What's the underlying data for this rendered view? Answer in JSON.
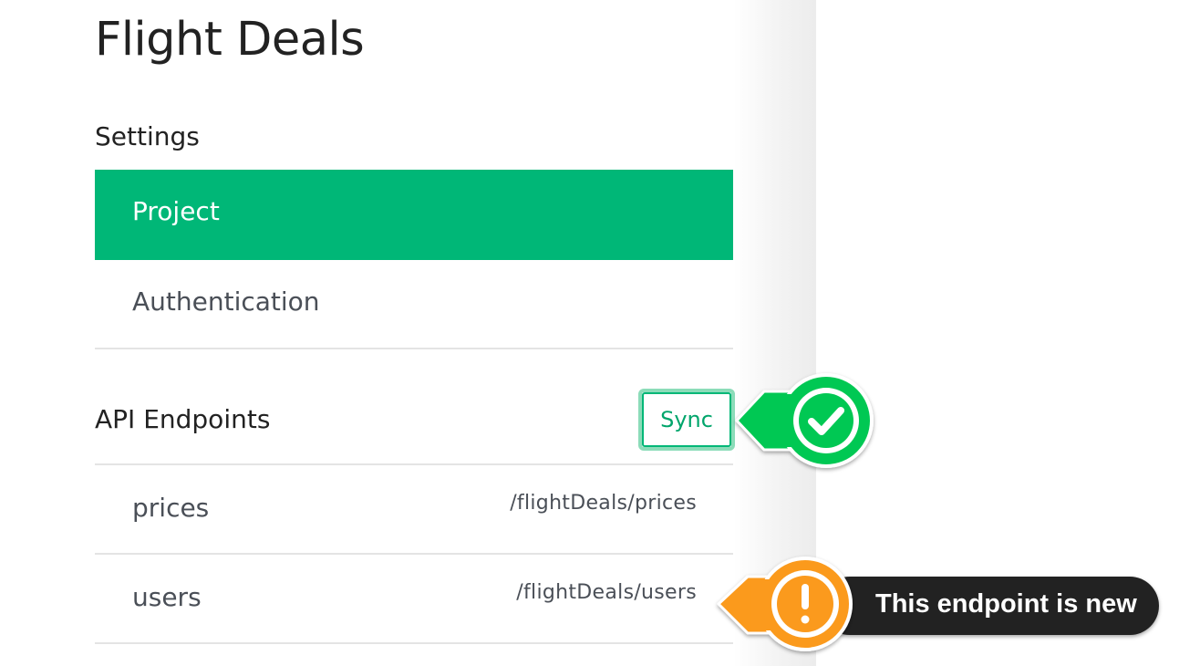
{
  "project": {
    "title": "Flight Deals"
  },
  "settings": {
    "heading": "Settings",
    "items": [
      {
        "label": "Project",
        "active": true
      },
      {
        "label": "Authentication",
        "active": false
      }
    ]
  },
  "api": {
    "heading": "API Endpoints",
    "sync_label": "Sync",
    "endpoints": [
      {
        "name": "prices",
        "path": "/flightDeals/prices"
      },
      {
        "name": "users",
        "path": "/flightDeals/users"
      }
    ]
  },
  "annotations": {
    "sync_status_icon": "checkmark-icon",
    "new_endpoint_icon": "exclamation-icon",
    "new_endpoint_text": "This endpoint is new"
  },
  "colors": {
    "accent": "#00b777",
    "success": "#00c853",
    "warning": "#fb9a1d",
    "tooltip_bg": "#222222"
  }
}
